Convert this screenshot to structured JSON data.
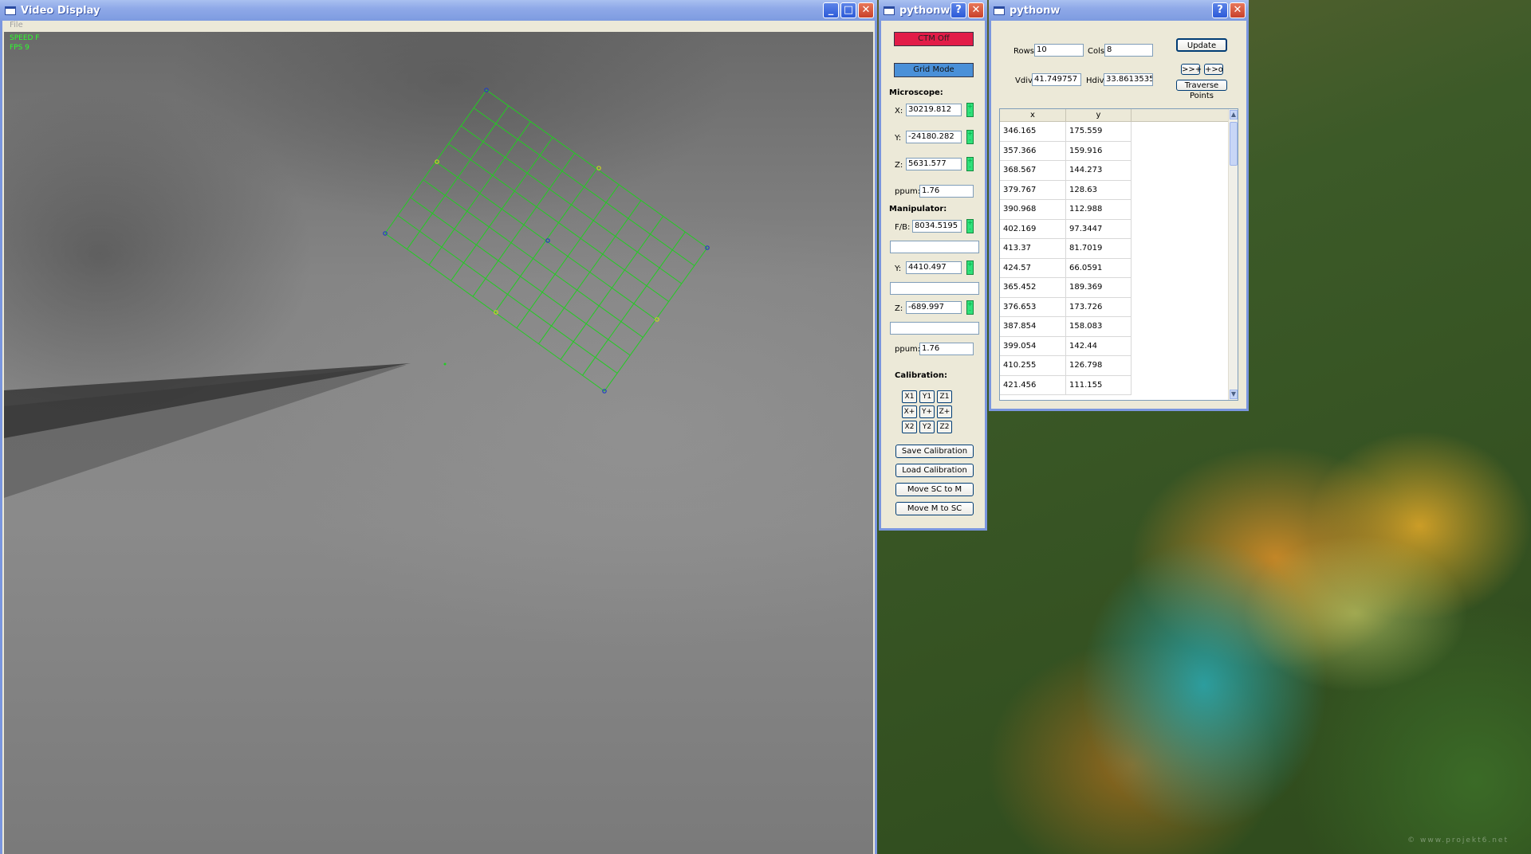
{
  "video_window": {
    "title": "Video Display",
    "menu_file": "File",
    "overlay_speed": "SPEED F",
    "overlay_fps": "FPS 9",
    "grid_color": "#22cc22"
  },
  "control_window": {
    "title": "pythonw",
    "ctm_button": "CTM Off",
    "grid_mode_button": "Grid Mode",
    "microscope_label": "Microscope:",
    "microscope": {
      "x_label": "X:",
      "x_value": "30219.812",
      "y_label": "Y:",
      "y_value": "-24180.282",
      "z_label": "Z:",
      "z_value": "5631.577",
      "ppum_label": "ppum:",
      "ppum_value": "1.76"
    },
    "manipulator_label": "Manipulator:",
    "manipulator": {
      "fb_label": "F/B:",
      "fb_value": "8034.5195",
      "y_label": "Y:",
      "y_value": "4410.497",
      "z_label": "Z:",
      "z_value": "-689.997",
      "ppum_label": "ppum:",
      "ppum_value": "1.76"
    },
    "calibration_label": "Calibration:",
    "calibration_buttons": [
      "X1",
      "Y1",
      "Z1",
      "X+",
      "Y+",
      "Z+",
      "X2",
      "Y2",
      "Z2"
    ],
    "save_calibration": "Save Calibration",
    "load_calibration": "Load Calibration",
    "move_sc_to_m": "Move SC to M",
    "move_m_to_sc": "Move M to SC",
    "accent_red": "#e21c48",
    "accent_blue": "#4a90d8"
  },
  "grid_window": {
    "title": "pythonw",
    "rows_label": "Rows",
    "rows_value": "10",
    "cols_label": "Cols",
    "cols_value": "8",
    "vdiv_label": "Vdiv",
    "vdiv_value": "41.749757",
    "hdiv_label": "Hdiv",
    "hdiv_value": "33.8613535",
    "update_button": "Update",
    "btn_forward": ">>+",
    "btn_back": "+>o",
    "traverse_button": "Traverse Points",
    "table_headers": [
      "x",
      "y"
    ],
    "table_rows": [
      [
        "346.165",
        "175.559"
      ],
      [
        "357.366",
        "159.916"
      ],
      [
        "368.567",
        "144.273"
      ],
      [
        "379.767",
        "128.63"
      ],
      [
        "390.968",
        "112.988"
      ],
      [
        "402.169",
        "97.3447"
      ],
      [
        "413.37",
        "81.7019"
      ],
      [
        "424.57",
        "66.0591"
      ],
      [
        "365.452",
        "189.369"
      ],
      [
        "376.653",
        "173.726"
      ],
      [
        "387.854",
        "158.083"
      ],
      [
        "399.054",
        "142.44"
      ],
      [
        "410.255",
        "126.798"
      ],
      [
        "421.456",
        "111.155"
      ]
    ]
  },
  "desktop": {
    "watermark": "© www.projekt6.net"
  },
  "icons": {
    "minimize": "minimize-icon",
    "maximize": "maximize-icon",
    "close": "close-icon",
    "help": "help-icon"
  }
}
